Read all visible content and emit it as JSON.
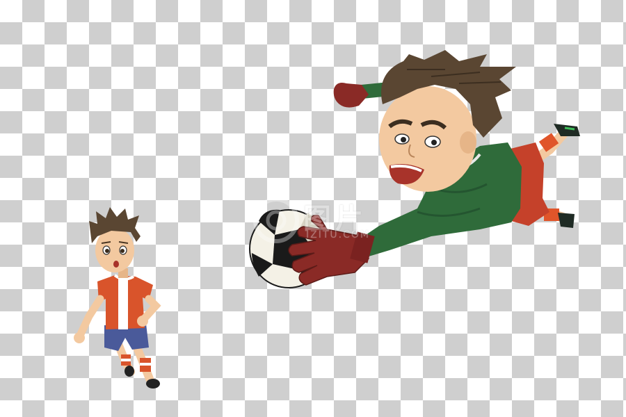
{
  "watermark": {
    "title": "图片",
    "subtitle": "IZITU.COM"
  },
  "colors": {
    "checker_dark": "#cfcfcf",
    "checker_light": "#ffffff",
    "goalkeeper_jersey": "#2f6b3a",
    "goalkeeper_glove": "#8a2a26",
    "player_jersey_orange": "#d9542b",
    "player_shorts": "#4a5a9a",
    "hair_brown": "#5a4632",
    "skin": "#f3c9a0"
  },
  "figures": [
    "diving-goalkeeper",
    "running-player",
    "soccer-ball"
  ]
}
